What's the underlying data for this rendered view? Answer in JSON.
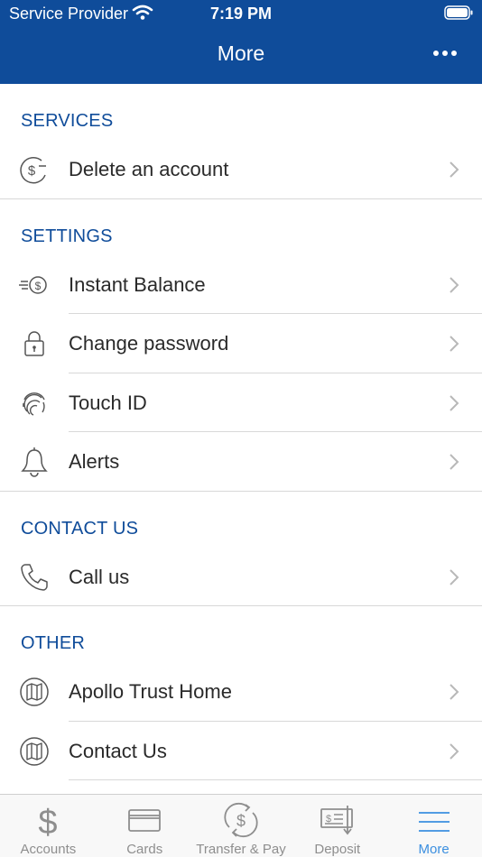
{
  "status_bar": {
    "carrier": "Service Provider",
    "time": "7:19 PM"
  },
  "header": {
    "title": "More"
  },
  "sections": [
    {
      "title": "SERVICES",
      "items": [
        {
          "label": "Delete an account",
          "icon": "dollar-remove-icon"
        }
      ]
    },
    {
      "title": "SETTINGS",
      "items": [
        {
          "label": "Instant Balance",
          "icon": "instant-balance-icon"
        },
        {
          "label": "Change password",
          "icon": "lock-icon"
        },
        {
          "label": "Touch ID",
          "icon": "fingerprint-icon"
        },
        {
          "label": "Alerts",
          "icon": "bell-icon"
        }
      ]
    },
    {
      "title": "CONTACT US",
      "items": [
        {
          "label": "Call us",
          "icon": "phone-icon"
        }
      ]
    },
    {
      "title": "OTHER",
      "items": [
        {
          "label": "Apollo Trust Home",
          "icon": "map-icon"
        },
        {
          "label": "Contact Us",
          "icon": "map-icon"
        }
      ]
    }
  ],
  "tabs": [
    {
      "label": "Accounts",
      "icon": "dollar-icon"
    },
    {
      "label": "Cards",
      "icon": "card-icon"
    },
    {
      "label": "Transfer & Pay",
      "icon": "transfer-icon"
    },
    {
      "label": "Deposit",
      "icon": "check-deposit-icon"
    },
    {
      "label": "More",
      "icon": "menu-icon",
      "active": true
    }
  ],
  "colors": {
    "brand": "#0f4c9a",
    "active_tab": "#3b8fe0",
    "inactive_tab": "#8e8e8e"
  }
}
